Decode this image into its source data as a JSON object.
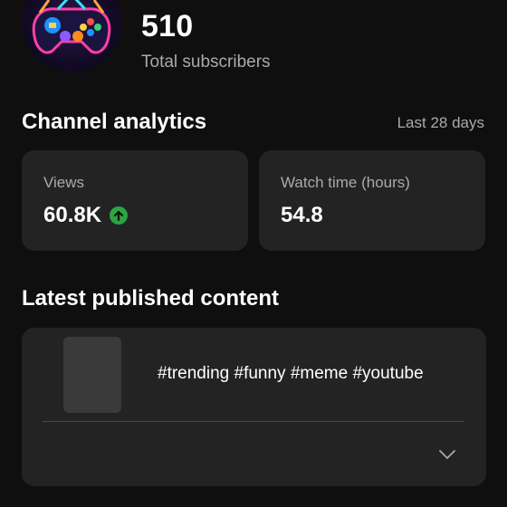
{
  "channel": {
    "subscriber_count": "510",
    "subscriber_label": "Total subscribers",
    "avatar_icon": "gamepad-logo-icon"
  },
  "analytics": {
    "title": "Channel analytics",
    "period": "Last 28 days",
    "cards": [
      {
        "label": "Views",
        "value": "60.8K",
        "trend_icon": "arrow-up-circle-icon",
        "trend_color": "#2ba640"
      },
      {
        "label": "Watch time (hours)",
        "value": "54.8"
      }
    ]
  },
  "latest": {
    "title": "Latest published content",
    "item": {
      "title": "#trending #funny #meme #youtube",
      "expand_icon": "chevron-down-icon"
    }
  },
  "colors": {
    "background": "#0f0f0f",
    "card": "#232323",
    "secondary_text": "#aaaaaa",
    "accent_green": "#2ba640"
  }
}
